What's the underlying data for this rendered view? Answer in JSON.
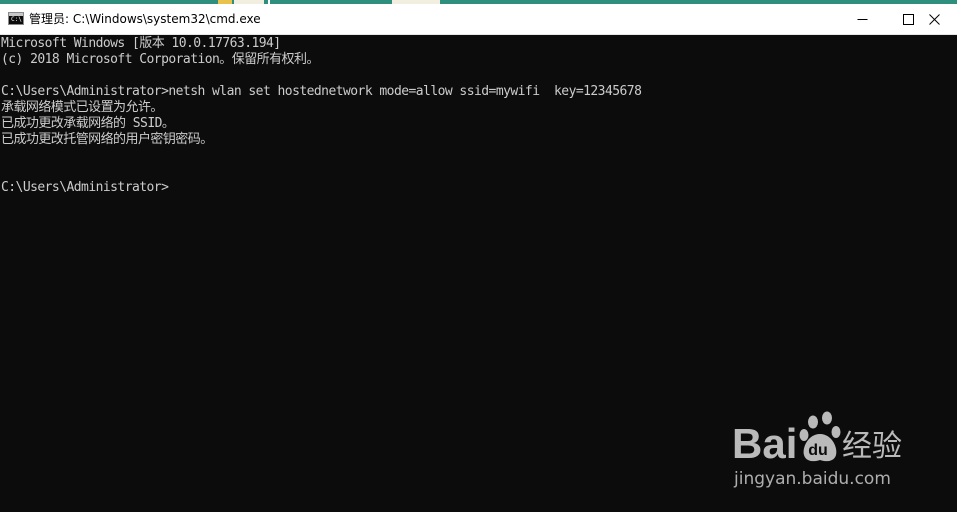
{
  "window": {
    "title": "管理员: C:\\Windows\\system32\\cmd.exe",
    "icon": "cmd-icon",
    "icon_prompt": "C:\\",
    "controls": {
      "minimize_glyph": "—",
      "maximize_glyph": "☐",
      "close_glyph": "✕"
    }
  },
  "console": {
    "foreground": "#cccccc",
    "background": "#0c0c0c",
    "lines": [
      "Microsoft Windows [版本 10.0.17763.194]",
      "(c) 2018 Microsoft Corporation。保留所有权利。",
      "",
      "C:\\Users\\Administrator>netsh wlan set hostednetwork mode=allow ssid=mywifi  key=12345678",
      "承载网络模式已设置为允许。",
      "已成功更改承载网络的 SSID。",
      "已成功更改托管网络的用户密钥密码。",
      "",
      "",
      "C:\\Users\\Administrator>"
    ]
  },
  "watermark": {
    "brand_left": "Bai",
    "brand_right": "经验",
    "url": "jingyan.baidu.com"
  }
}
